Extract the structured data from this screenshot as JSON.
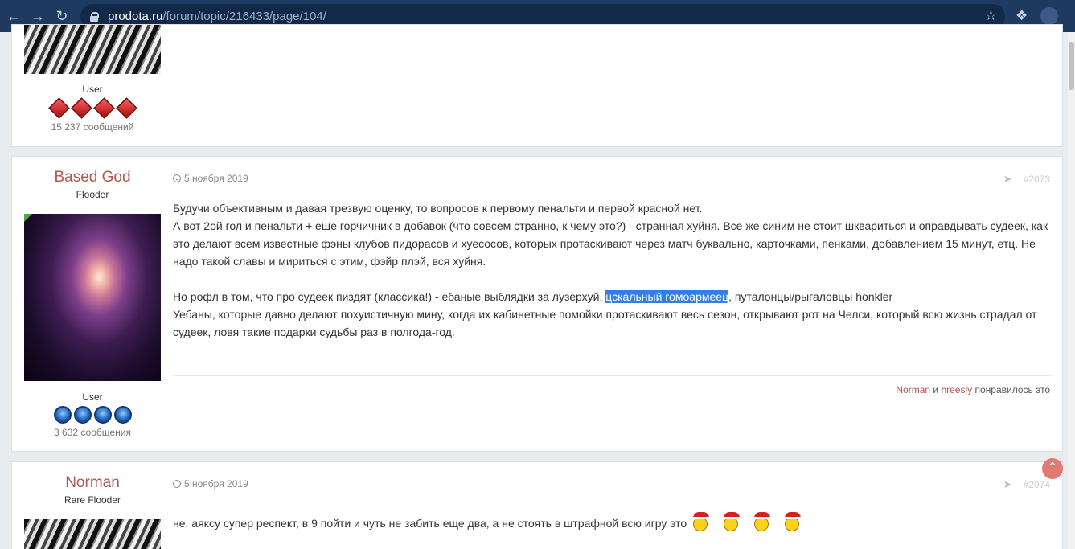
{
  "browser": {
    "url_host": "prodota.ru",
    "url_path": "/forum/topic/216433/page/104/"
  },
  "colors": {
    "accent": "#b0584e",
    "chrome": "#1f3a61",
    "highlight": "#2f7fe6"
  },
  "posts": [
    {
      "role": "User",
      "post_count": "15 237 сообщений",
      "badge_type": "red"
    },
    {
      "author": "Based God",
      "title": "Flooder",
      "role": "User",
      "post_count": "3 632 сообщения",
      "date": "5 ноября 2019",
      "number": "#2073",
      "lines": [
        "Будучи объективным и давая трезвую оценку, то вопросов к первому пенальти и первой красной нет.",
        "А вот 2ой гол и пенальти + еще горчичник в добавок (что совсем странно, к чему это?) - странная хуйня. Все же синим не стоит шквариться и оправдывать судеек, как это делают всем известные фэны клубов пидорасов и хуесосов, которых протаскивают через матч буквально, карточками, пенками, добавлением 15 минут, етц. Не надо такой славы и мириться с этим, фэйр плэй, вся хуйня."
      ],
      "line3_before": "Но рофл в том, что про судеек пиздят (классика!) - ебаные выблядки за лузерхуй, ",
      "line3_highlight": "цскальный гомоармеец",
      "line3_after": ", путалонцы/рыгаловцы  honkler",
      "line4": "Уебаны, которые давно делают похуистичную мину, когда их кабинетные помойки протаскивают весь сезон, открывают рот на Челси, который всю жизнь страдал от судеек, ловя такие подарки судьбы раз в полгода-год.",
      "likes": {
        "user1": "Norman",
        "and": "и",
        "user2": "hreesly",
        "suffix": "понравилось это"
      }
    },
    {
      "author": "Norman",
      "title": "Rare Flooder",
      "date": "5 ноября 2019",
      "number": "#2074",
      "text": "не, аяксу супер респект, в 9 пойти и чуть не забить еще два, а не стоять в штрафной всю игру это"
    }
  ]
}
